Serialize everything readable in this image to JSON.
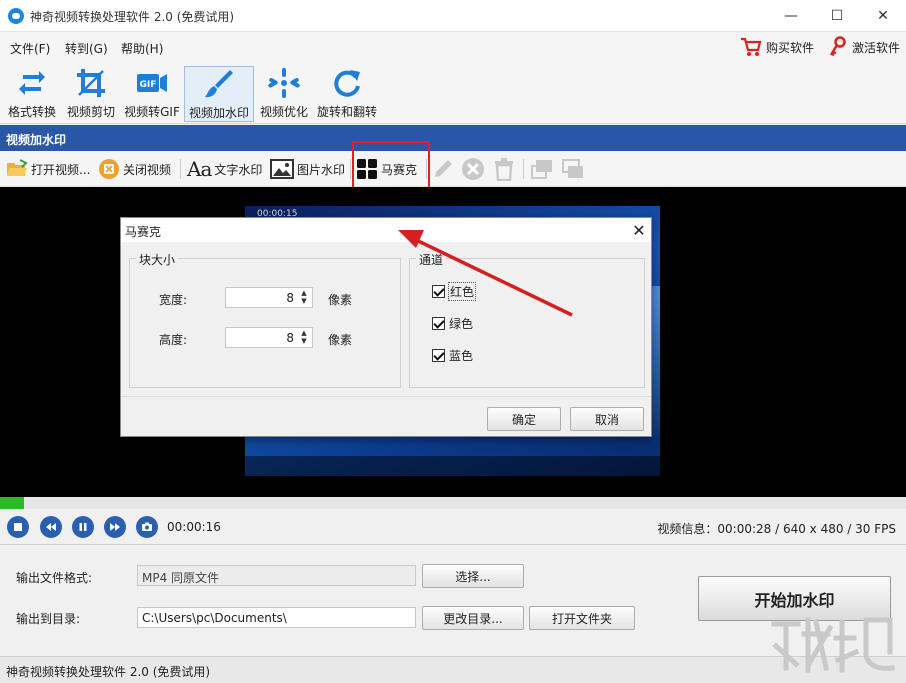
{
  "window": {
    "title": "神奇视频转换处理软件 2.0 (免费试用)",
    "minimize": "—",
    "maximize": "☐",
    "close": "✕"
  },
  "menu": {
    "items": [
      "文件(F)",
      "转到(G)",
      "帮助(H)"
    ],
    "buy": "购买软件",
    "activate": "激活软件"
  },
  "toolbar": {
    "tools": [
      {
        "label": "格式转换",
        "icon": "convert-icon"
      },
      {
        "label": "视频剪切",
        "icon": "crop-icon"
      },
      {
        "label": "视频转GIF",
        "icon": "gif-icon"
      },
      {
        "label": "视频加水印",
        "icon": "brush-icon",
        "active": true
      },
      {
        "label": "视频优化",
        "icon": "optimize-icon"
      },
      {
        "label": "旋转和翻转",
        "icon": "rotate-icon"
      }
    ]
  },
  "section": {
    "title": "视频加水印"
  },
  "subtoolbar": {
    "open_video": "打开视频...",
    "close_video": "关闭视频",
    "text_watermark": "文字水印",
    "image_watermark": "图片水印",
    "mosaic": "马赛克"
  },
  "preview": {
    "timestamp": "00:00:15"
  },
  "playback": {
    "progress": 0.027,
    "current_time": "00:00:16",
    "video_info": "视频信息：00:00:28 / 640 x 480 / 30 FPS"
  },
  "output": {
    "format_label": "输出文件格式:",
    "format_value": "MP4 同原文件",
    "select_button": "选择...",
    "dir_label": "输出到目录:",
    "dir_value": "C:\\Users\\pc\\Documents\\",
    "change_dir_button": "更改目录...",
    "open_folder_button": "打开文件夹",
    "start_button": "开始加水印"
  },
  "statusbar": {
    "text": "神奇视频转换处理软件 2.0 (免费试用)"
  },
  "dialog": {
    "title": "马赛克",
    "close": "✕",
    "block_group": "块大小",
    "width_label": "宽度:",
    "width_value": "8",
    "height_label": "高度:",
    "height_value": "8",
    "unit": "像素",
    "channel_group": "通道",
    "channels": [
      {
        "label": "红色",
        "checked": true
      },
      {
        "label": "绿色",
        "checked": true
      },
      {
        "label": "蓝色",
        "checked": true
      }
    ],
    "ok": "确定",
    "cancel": "取消"
  },
  "colors": {
    "accent": "#2a56a8",
    "highlight": "#e2201f",
    "progress": "#2eb82e"
  }
}
